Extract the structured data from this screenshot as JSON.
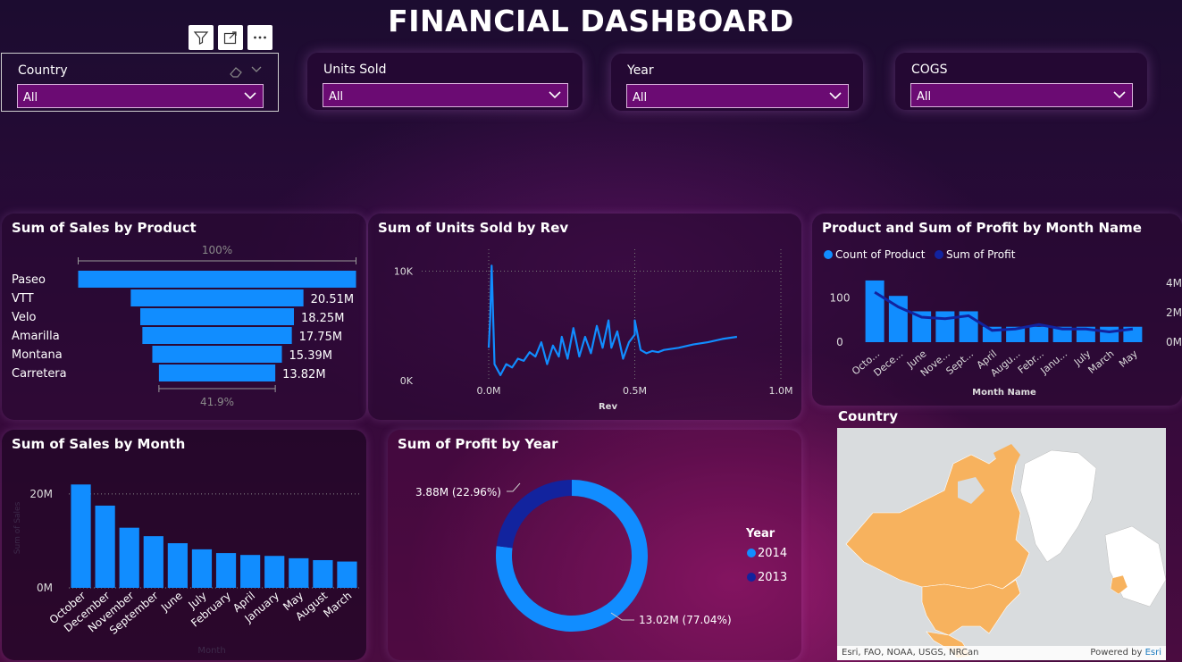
{
  "title": "FINANCIAL DASHBOARD",
  "colors": {
    "bar": "#118dff",
    "dark_series": "#12239e",
    "map_land": "#f7b25e",
    "map_ocean": "#d9dcde"
  },
  "slicers": [
    {
      "label": "Country",
      "value": "All"
    },
    {
      "label": "Units Sold",
      "value": "All"
    },
    {
      "label": "Year",
      "value": "All"
    },
    {
      "label": "COGS",
      "value": "All"
    }
  ],
  "funnel": {
    "title": "Sum of Sales by Product",
    "top_pct": "100%",
    "bottom_pct": "41.9%",
    "chart_data": {
      "type": "bar",
      "categories": [
        "Paseo",
        "VTT",
        "Velo",
        "Amarilla",
        "Montana",
        "Carretera"
      ],
      "values": [
        33.0,
        20.51,
        18.25,
        17.75,
        15.39,
        13.82
      ],
      "data_labels": [
        "",
        "20.51M",
        "18.25M",
        "17.75M",
        "15.39M",
        "13.82M"
      ]
    }
  },
  "line_chart": {
    "title": "Sum of Units Sold by Rev",
    "chart_data": {
      "type": "line",
      "xlabel": "Rev",
      "ylabel": "",
      "x_ticks": [
        "0.0M",
        "0.5M",
        "1.0M"
      ],
      "y_ticks": [
        "0K",
        "10K"
      ],
      "xlim": [
        0,
        1.0
      ],
      "ylim": [
        0,
        12000
      ],
      "series": [
        {
          "x": [
            0.0,
            0.005,
            0.01,
            0.02,
            0.03,
            0.04,
            0.06,
            0.08,
            0.1,
            0.12,
            0.14,
            0.16,
            0.18,
            0.2,
            0.22,
            0.24,
            0.25,
            0.27,
            0.29,
            0.31,
            0.33,
            0.35,
            0.37,
            0.39,
            0.41,
            0.42,
            0.44,
            0.46,
            0.48,
            0.5,
            0.5,
            0.52,
            0.54,
            0.56,
            0.58,
            0.6,
            0.65,
            0.7,
            0.75,
            0.8,
            0.85
          ],
          "y": [
            3000,
            5500,
            10500,
            1500,
            1000,
            500,
            1500,
            1200,
            2000,
            1800,
            2600,
            2200,
            3500,
            1500,
            3200,
            2200,
            4000,
            2000,
            4800,
            2200,
            4000,
            2500,
            5000,
            3000,
            5500,
            3000,
            4500,
            2000,
            3500,
            4200,
            5500,
            2800,
            2500,
            2700,
            2600,
            2800,
            3000,
            3300,
            3500,
            3800,
            4000
          ]
        }
      ]
    }
  },
  "combo_chart": {
    "title": "Product and Sum of Profit by Month Name",
    "legend": [
      "Count of Product",
      "Sum of Profit"
    ],
    "chart_data": {
      "type": "bar",
      "xlabel": "Month Name",
      "left_ticks": [
        "0",
        "100"
      ],
      "right_ticks": [
        "0M",
        "2M",
        "4M"
      ],
      "categories": [
        "October",
        "December",
        "June",
        "November",
        "September",
        "April",
        "August",
        "February",
        "January",
        "July",
        "March",
        "May"
      ],
      "category_labels": [
        "Octo...",
        "Dece...",
        "June",
        "Nove...",
        "Sept...",
        "April",
        "Augu...",
        "Febr...",
        "Janu...",
        "July",
        "March",
        "May"
      ],
      "bar_values": [
        140,
        105,
        70,
        70,
        70,
        35,
        35,
        35,
        35,
        35,
        35,
        35
      ],
      "line_values": [
        3.4,
        2.4,
        1.7,
        1.6,
        1.8,
        0.8,
        0.9,
        1.2,
        0.9,
        0.9,
        0.7,
        0.9
      ]
    }
  },
  "month_chart": {
    "title": "Sum of Sales by Month",
    "chart_data": {
      "type": "bar",
      "xlabel": "Month",
      "ylabel": "Sum of Sales",
      "y_ticks": [
        "0M",
        "20M"
      ],
      "ylim": [
        0,
        27
      ],
      "categories": [
        "October",
        "December",
        "November",
        "September",
        "June",
        "July",
        "February",
        "April",
        "January",
        "May",
        "August",
        "March"
      ],
      "values": [
        22.0,
        17.5,
        12.8,
        11.0,
        9.5,
        8.2,
        7.4,
        7.0,
        6.8,
        6.3,
        5.9,
        5.6
      ]
    }
  },
  "donut": {
    "title": "Sum of Profit by Year",
    "legend_title": "Year",
    "chart_data": {
      "type": "pie",
      "categories": [
        "2014",
        "2013"
      ],
      "values": [
        13.02,
        3.88
      ],
      "data_labels": [
        "13.02M (77.04%)",
        "3.88M (22.96%)"
      ]
    }
  },
  "map": {
    "title": "Country",
    "attribution": "Esri, FAO, NOAA, USGS, NRCan",
    "powered_by": "Powered by",
    "powered_brand": "Esri"
  }
}
